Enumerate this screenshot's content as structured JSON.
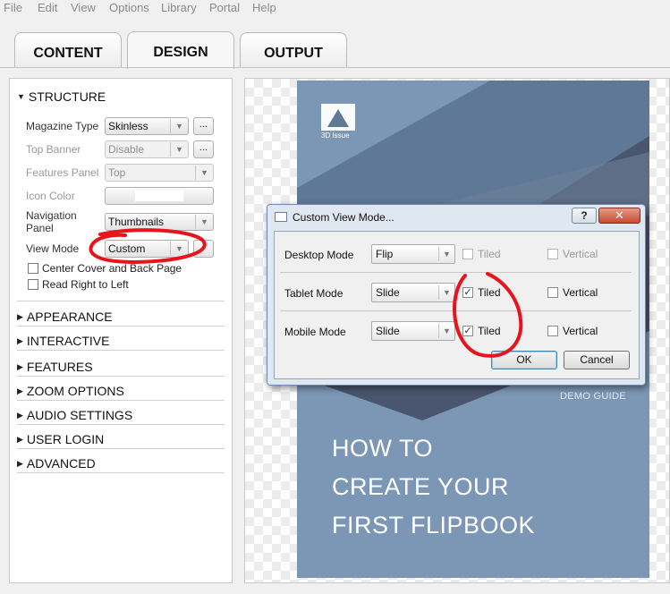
{
  "menu": [
    "File",
    "Edit",
    "View",
    "Options",
    "Library",
    "Portal",
    "Help"
  ],
  "tabs": [
    {
      "label": "CONTENT",
      "active": false
    },
    {
      "label": "DESIGN",
      "active": true
    },
    {
      "label": "OUTPUT",
      "active": false
    }
  ],
  "structure": {
    "header": "STRUCTURE",
    "magazine_type": {
      "label": "Magazine Type",
      "value": "Skinless",
      "more": "..."
    },
    "top_banner": {
      "label": "Top Banner",
      "value": "Disable",
      "more": "..."
    },
    "features_panel": {
      "label": "Features Panel",
      "value": "Top"
    },
    "icon_color": {
      "label": "Icon Color",
      "color": "#ffffff"
    },
    "navigation_panel": {
      "label_line1": "Navigation",
      "label_line2": "Panel",
      "value": "Thumbnails"
    },
    "view_mode": {
      "label": "View Mode",
      "value": "Custom"
    },
    "center_cover": {
      "label": "Center Cover and Back Page",
      "checked": false
    },
    "read_right_to_left": {
      "label": "Read Right to Left",
      "checked": false
    }
  },
  "sections": [
    "APPEARANCE",
    "INTERACTIVE",
    "FEATURES",
    "ZOOM OPTIONS",
    "AUDIO SETTINGS",
    "USER LOGIN",
    "ADVANCED"
  ],
  "cover": {
    "logo_text": "3D Issue",
    "demo_guide": "DEMO GUIDE",
    "title_lines": [
      "HOW TO",
      "CREATE YOUR",
      "FIRST FLIPBOOK"
    ],
    "colors": {
      "dark": "#4a566d",
      "mid": "#5f7896",
      "light": "#7c97b6"
    }
  },
  "dialog": {
    "title": "Custom View Mode...",
    "help": "?",
    "close": "✕",
    "rows": [
      {
        "label": "Desktop Mode",
        "value": "Flip",
        "tiled_label": "Tiled",
        "tiled": false,
        "tiled_enabled": false,
        "vertical_label": "Vertical",
        "vertical": false,
        "vertical_enabled": false
      },
      {
        "label": "Tablet Mode",
        "value": "Slide",
        "tiled_label": "Tiled",
        "tiled": true,
        "tiled_enabled": true,
        "vertical_label": "Vertical",
        "vertical": false,
        "vertical_enabled": true
      },
      {
        "label": "Mobile Mode",
        "value": "Slide",
        "tiled_label": "Tiled",
        "tiled": true,
        "tiled_enabled": true,
        "vertical_label": "Vertical",
        "vertical": false,
        "vertical_enabled": true
      }
    ],
    "ok": "OK",
    "cancel": "Cancel"
  },
  "annotation_color": "#e8141c"
}
